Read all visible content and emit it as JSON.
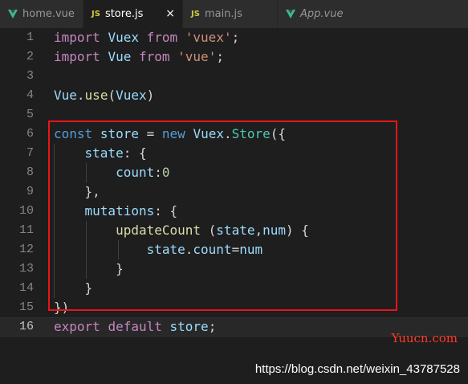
{
  "tabs": [
    {
      "label": "home.vue",
      "icon": "vue-icon",
      "active": false
    },
    {
      "label": "store.js",
      "icon": "js-icon",
      "icon_text": "JS",
      "active": true,
      "close": "×"
    },
    {
      "label": "main.js",
      "icon": "js-icon",
      "icon_text": "JS",
      "active": false
    },
    {
      "label": "App.vue",
      "icon": "vue-icon",
      "active": false,
      "italic": true
    }
  ],
  "editor": {
    "current_line": 16,
    "lines": [
      {
        "n": "1",
        "t": [
          [
            "import",
            "kw-ctl"
          ],
          [
            " ",
            "pl"
          ],
          [
            "Vuex",
            "id"
          ],
          [
            " ",
            "pl"
          ],
          [
            "from",
            "kw-ctl"
          ],
          [
            " ",
            "pl"
          ],
          [
            "'vuex'",
            "str"
          ],
          [
            ";",
            "pl"
          ]
        ]
      },
      {
        "n": "2",
        "t": [
          [
            "import",
            "kw-ctl"
          ],
          [
            " ",
            "pl"
          ],
          [
            "Vue",
            "id"
          ],
          [
            " ",
            "pl"
          ],
          [
            "from",
            "kw-ctl"
          ],
          [
            " ",
            "pl"
          ],
          [
            "'vue'",
            "str"
          ],
          [
            ";",
            "pl"
          ]
        ]
      },
      {
        "n": "3",
        "t": []
      },
      {
        "n": "4",
        "t": [
          [
            "Vue",
            "id"
          ],
          [
            ".",
            "pl"
          ],
          [
            "use",
            "fn"
          ],
          [
            "(",
            "pl"
          ],
          [
            "Vuex",
            "id"
          ],
          [
            ")",
            "pl"
          ]
        ]
      },
      {
        "n": "5",
        "t": []
      },
      {
        "n": "6",
        "t": [
          [
            "const",
            "kw"
          ],
          [
            " ",
            "pl"
          ],
          [
            "store",
            "id"
          ],
          [
            " = ",
            "pl"
          ],
          [
            "new",
            "kw"
          ],
          [
            " ",
            "pl"
          ],
          [
            "Vuex",
            "id"
          ],
          [
            ".",
            "pl"
          ],
          [
            "Store",
            "cls"
          ],
          [
            "({",
            "pl"
          ]
        ]
      },
      {
        "n": "7",
        "t": [
          [
            "    ",
            "pl"
          ],
          [
            "state",
            "id"
          ],
          [
            ": {",
            "pl"
          ]
        ]
      },
      {
        "n": "8",
        "t": [
          [
            "        ",
            "pl"
          ],
          [
            "count",
            "id"
          ],
          [
            ":",
            "pl"
          ],
          [
            "0",
            "num"
          ]
        ]
      },
      {
        "n": "9",
        "t": [
          [
            "    ",
            "pl"
          ],
          [
            "},",
            "pl"
          ]
        ]
      },
      {
        "n": "10",
        "t": [
          [
            "    ",
            "pl"
          ],
          [
            "mutations",
            "id"
          ],
          [
            ": {",
            "pl"
          ]
        ]
      },
      {
        "n": "11",
        "t": [
          [
            "        ",
            "pl"
          ],
          [
            "updateCount",
            "fn"
          ],
          [
            " (",
            "pl"
          ],
          [
            "state",
            "id"
          ],
          [
            ",",
            "pl"
          ],
          [
            "num",
            "id"
          ],
          [
            ") {",
            "pl"
          ]
        ]
      },
      {
        "n": "12",
        "t": [
          [
            "            ",
            "pl"
          ],
          [
            "state",
            "id"
          ],
          [
            ".",
            "pl"
          ],
          [
            "count",
            "id"
          ],
          [
            "=",
            "pl"
          ],
          [
            "num",
            "id"
          ]
        ]
      },
      {
        "n": "13",
        "t": [
          [
            "        ",
            "pl"
          ],
          [
            "}",
            "pl"
          ]
        ]
      },
      {
        "n": "14",
        "t": [
          [
            "    ",
            "pl"
          ],
          [
            "}",
            "pl"
          ]
        ]
      },
      {
        "n": "15",
        "t": [
          [
            "})",
            "pl"
          ]
        ]
      },
      {
        "n": "16",
        "t": [
          [
            "export",
            "kw-ctl"
          ],
          [
            " ",
            "pl"
          ],
          [
            "default",
            "kw-ctl"
          ],
          [
            " ",
            "pl"
          ],
          [
            "store",
            "id"
          ],
          [
            ";",
            "pl"
          ]
        ]
      }
    ]
  },
  "watermark": {
    "site": "Yuucn.com",
    "url": "https://blog.csdn.net/weixin_43787528"
  },
  "colors": {
    "highlight_box": "#e8141b",
    "background": "#1e1e1e"
  }
}
